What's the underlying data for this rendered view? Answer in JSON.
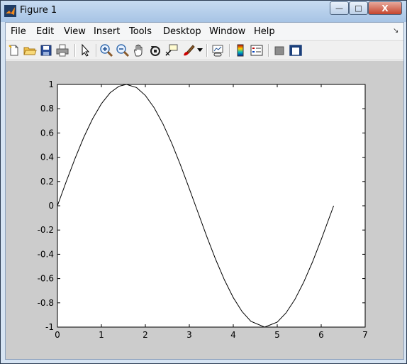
{
  "window": {
    "title": "Figure 1",
    "controls": {
      "minimize": "—",
      "maximize": "□",
      "close": "X"
    }
  },
  "menubar": {
    "items": [
      {
        "id": "file",
        "label": "File"
      },
      {
        "id": "edit",
        "label": "Edit"
      },
      {
        "id": "view",
        "label": "View"
      },
      {
        "id": "insert",
        "label": "Insert"
      },
      {
        "id": "tools",
        "label": "Tools"
      },
      {
        "id": "desktop",
        "label": "Desktop"
      },
      {
        "id": "window",
        "label": "Window"
      },
      {
        "id": "help",
        "label": "Help"
      }
    ]
  },
  "toolbar": {
    "icons": [
      "new-figure-icon",
      "open-file-icon",
      "save-figure-icon",
      "print-figure-icon",
      "edit-plot-icon",
      "zoom-in-icon",
      "zoom-out-icon",
      "pan-icon",
      "rotate-3d-icon",
      "data-cursor-icon",
      "brush-icon",
      "link-plot-icon",
      "insert-colorbar-icon",
      "insert-legend-icon",
      "hide-plot-tools-icon",
      "show-plot-tools-icon"
    ]
  },
  "chart_data": {
    "type": "line",
    "title": "",
    "xlabel": "",
    "ylabel": "",
    "xlim": [
      0,
      7
    ],
    "ylim": [
      -1,
      1
    ],
    "xticks": [
      "0",
      "1",
      "2",
      "3",
      "4",
      "5",
      "6",
      "7"
    ],
    "yticks": [
      "-1",
      "-0.8",
      "-0.6",
      "-0.4",
      "-0.2",
      "0",
      "0.2",
      "0.4",
      "0.6",
      "0.8",
      "1"
    ],
    "xtick_values": [
      0,
      1,
      2,
      3,
      4,
      5,
      6,
      7
    ],
    "ytick_values": [
      -1,
      -0.8,
      -0.6,
      -0.4,
      -0.2,
      0,
      0.2,
      0.4,
      0.6,
      0.8,
      1
    ],
    "grid": false,
    "series": [
      {
        "color": "#000000",
        "x": [
          0,
          0.2,
          0.4,
          0.6,
          0.8,
          1.0,
          1.2,
          1.4,
          1.5708,
          1.8,
          2.0,
          2.2,
          2.4,
          2.6,
          2.8,
          3.0,
          3.1416,
          3.4,
          3.6,
          3.8,
          4.0,
          4.2,
          4.4,
          4.7124,
          5.0,
          5.2,
          5.4,
          5.6,
          5.8,
          6.0,
          6.2832
        ],
        "y": [
          0,
          0.199,
          0.389,
          0.565,
          0.717,
          0.841,
          0.932,
          0.985,
          1.0,
          0.974,
          0.909,
          0.808,
          0.675,
          0.516,
          0.335,
          0.141,
          0.0,
          -0.256,
          -0.443,
          -0.612,
          -0.757,
          -0.872,
          -0.952,
          -1.0,
          -0.959,
          -0.883,
          -0.773,
          -0.631,
          -0.465,
          -0.279,
          0.0
        ]
      }
    ]
  }
}
